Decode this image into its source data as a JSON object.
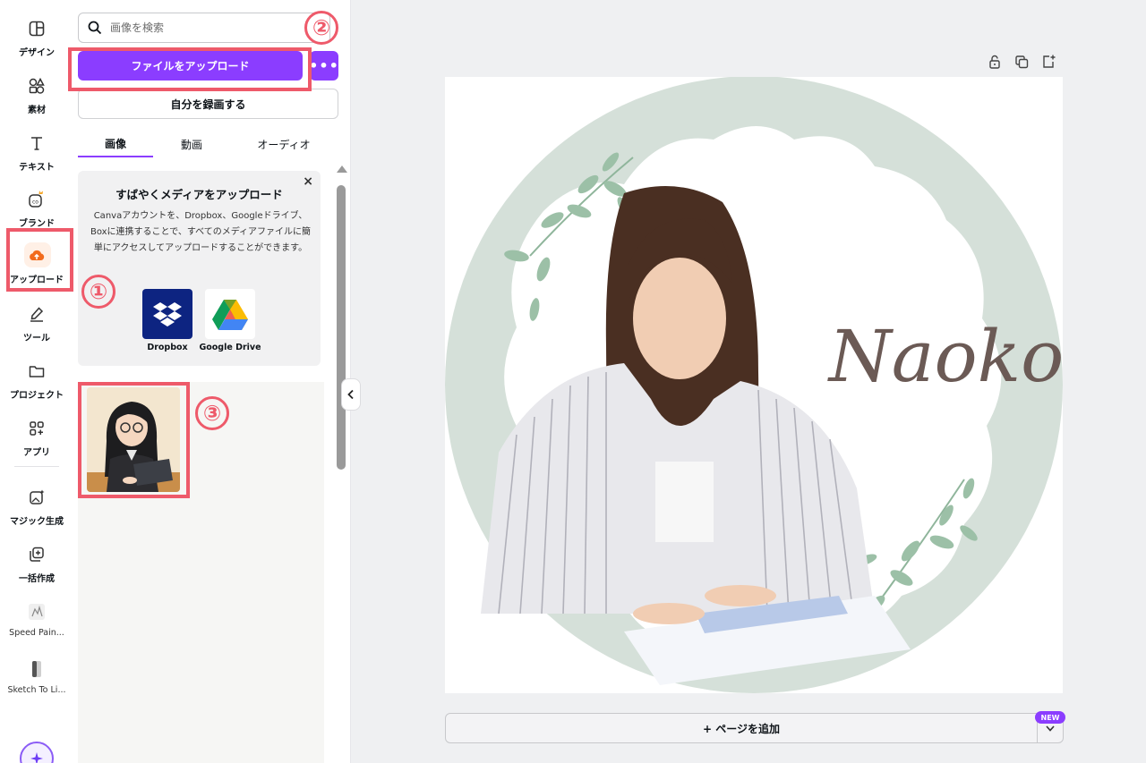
{
  "rail": {
    "items": [
      {
        "label": "デザイン",
        "icon": "layout-icon"
      },
      {
        "label": "素材",
        "icon": "shapes-icon"
      },
      {
        "label": "テキスト",
        "icon": "text-icon"
      },
      {
        "label": "ブランド",
        "icon": "brand-icon"
      },
      {
        "label": "アップロード",
        "icon": "cloud-upload-icon"
      },
      {
        "label": "ツール",
        "icon": "pen-tool-icon"
      },
      {
        "label": "プロジェクト",
        "icon": "folder-icon"
      },
      {
        "label": "アプリ",
        "icon": "apps-icon"
      },
      {
        "label": "マジック生成",
        "icon": "magic-image-icon"
      },
      {
        "label": "一括作成",
        "icon": "bulk-create-icon"
      },
      {
        "label": "Speed Pain...",
        "icon": "speed-paint-app-icon"
      },
      {
        "label": "Sketch To Li...",
        "icon": "sketch-app-icon"
      }
    ]
  },
  "panel": {
    "search_placeholder": "画像を検索",
    "upload_button": "ファイルをアップロード",
    "more_button": "•••",
    "record_button": "自分を録画する",
    "tabs": [
      {
        "label": "画像",
        "active": true
      },
      {
        "label": "動画",
        "active": false
      },
      {
        "label": "オーディオ",
        "active": false
      }
    ],
    "promo": {
      "close": "×",
      "title": "すばやくメディアをアップロード",
      "body": "Canvaアカウントを、Dropbox、Googleドライブ、Boxに連携することで、すべてのメディアファイルに簡単にアクセスしてアップロードすることができます。",
      "apps": [
        {
          "label": "Dropbox",
          "icon": "dropbox-icon"
        },
        {
          "label": "Google Drive",
          "icon": "google-drive-icon"
        }
      ]
    }
  },
  "annotations": {
    "one": "①",
    "two": "②",
    "three": "③"
  },
  "canvas": {
    "signature": "Naoko"
  },
  "footer": {
    "add_page": "+ ページを追加",
    "new_badge": "NEW"
  },
  "colors": {
    "accent": "#8b3dff",
    "annotation": "#ee5a6a",
    "frame": "#d5e0d9"
  }
}
